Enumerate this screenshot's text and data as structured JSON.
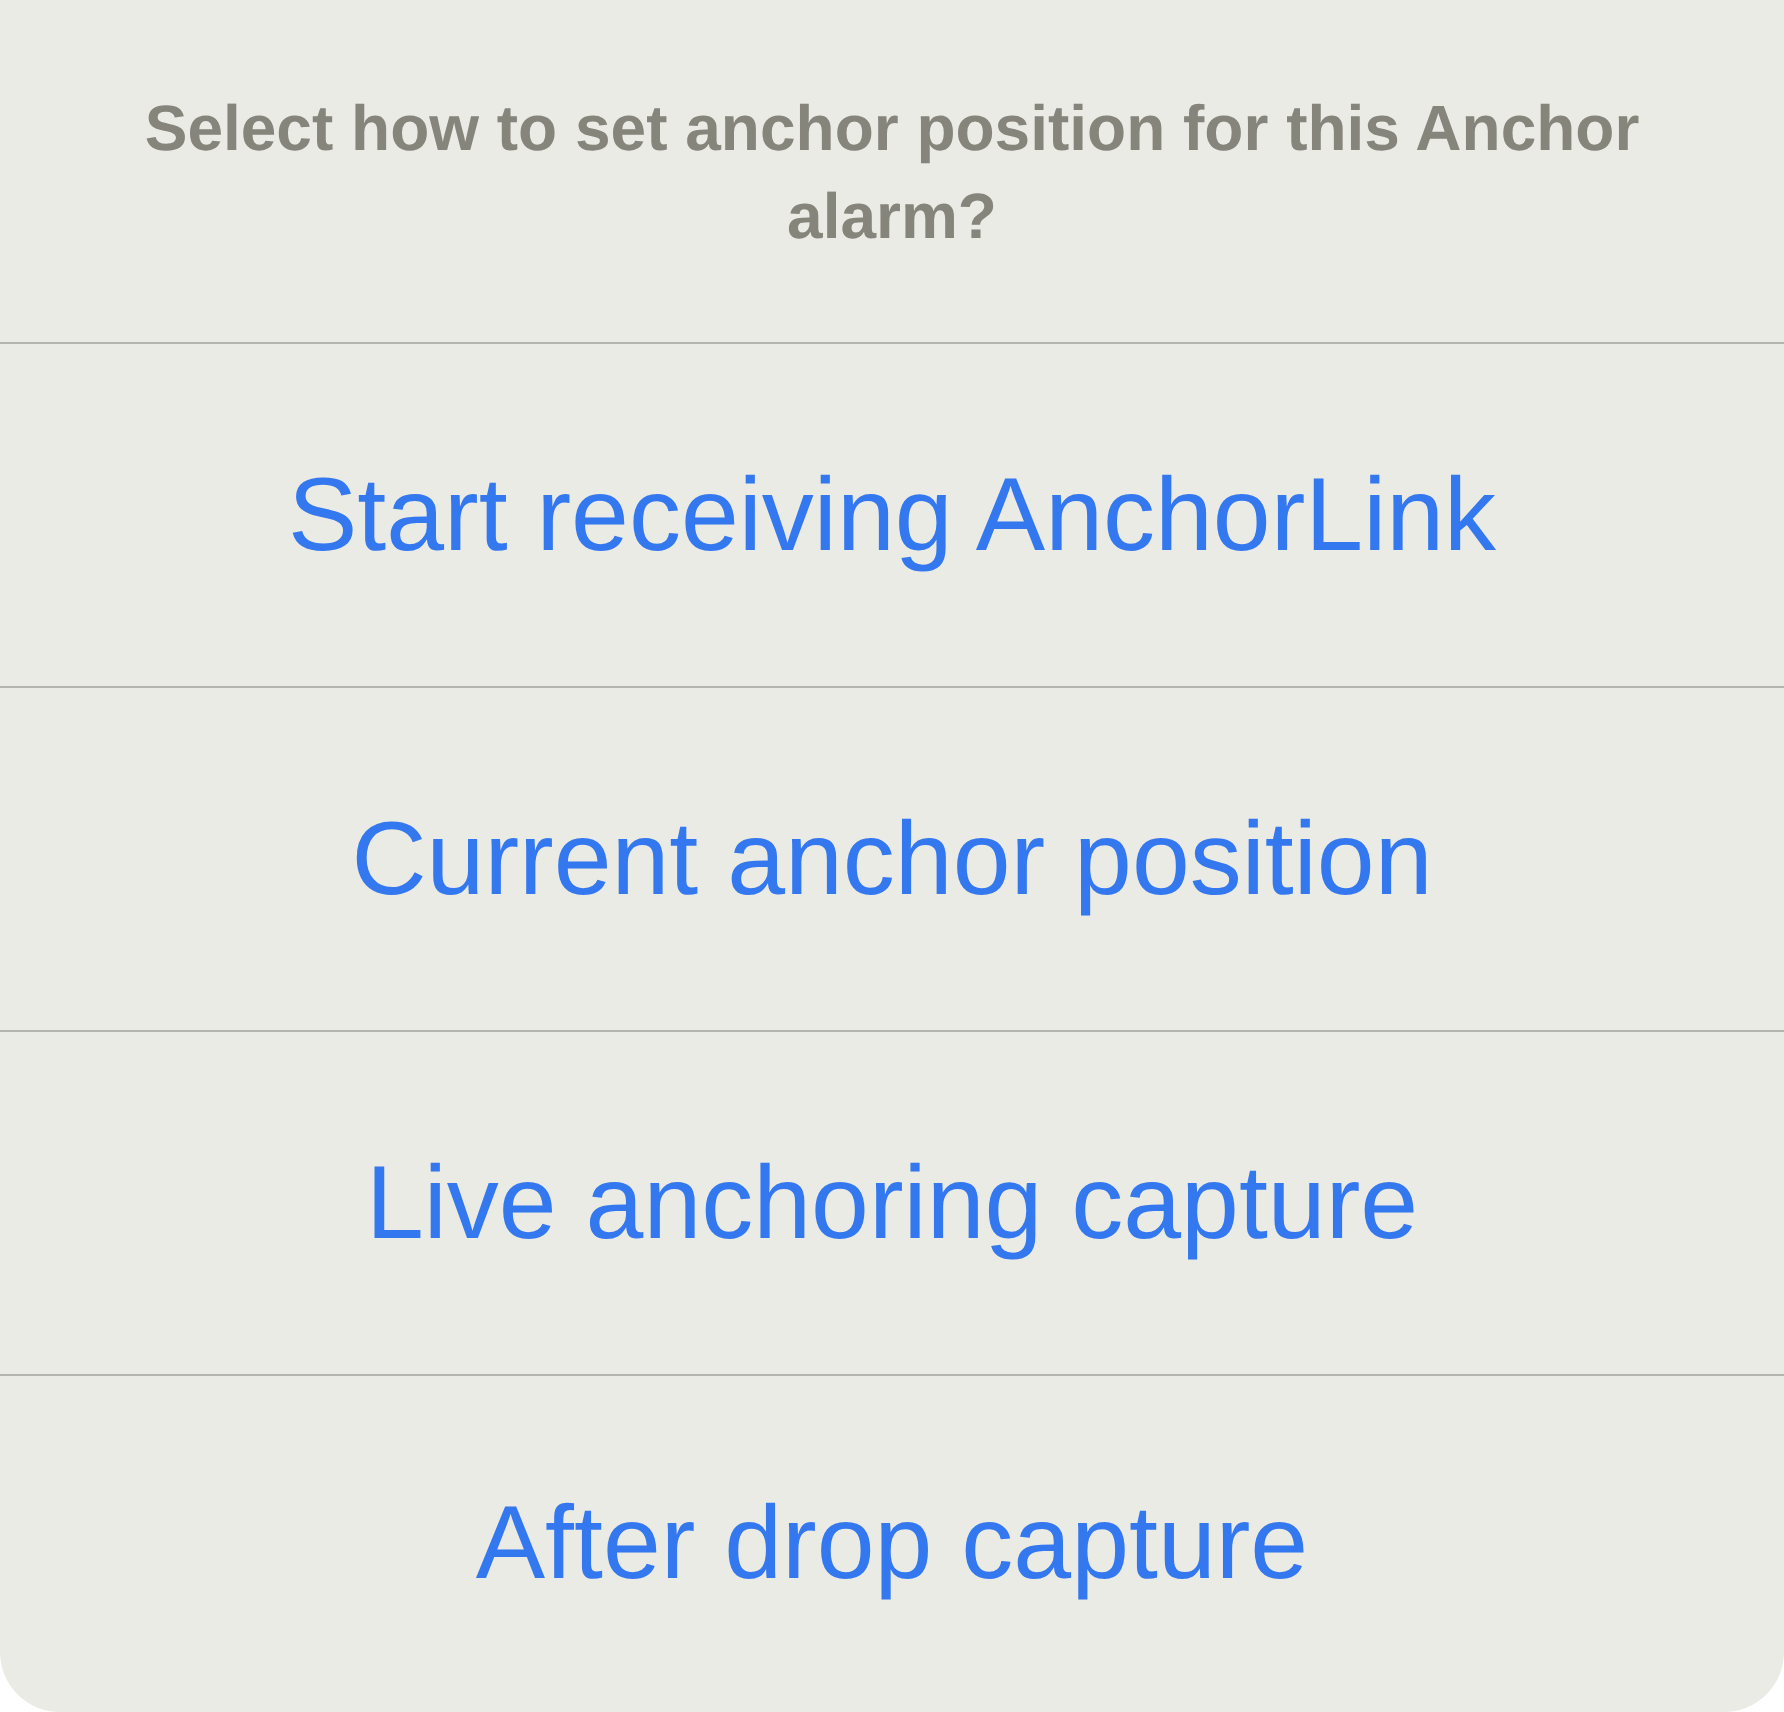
{
  "action_sheet": {
    "message": "Select how to set anchor position for this Anchor alarm?",
    "actions": [
      {
        "label": "Start receiving AnchorLink"
      },
      {
        "label": "Current anchor position"
      },
      {
        "label": "Live anchoring capture"
      },
      {
        "label": "After drop capture"
      }
    ]
  }
}
